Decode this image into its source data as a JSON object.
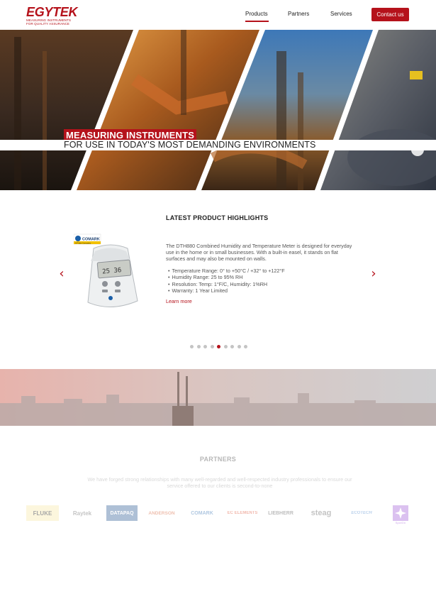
{
  "header": {
    "logo_name": "EGYTEK",
    "logo_tagline_1": "MEASURING INSTRUMENTS",
    "logo_tagline_2": "FOR QUALITY ASSURANCE",
    "nav": {
      "products": "Products",
      "partners": "Partners",
      "services": "Services"
    },
    "contact_label": "Contact us"
  },
  "hero": {
    "title": "MEASURING INSTRUMENTS",
    "subtitle": "FOR USE IN TODAY'S MOST DEMANDING ENVIRONMENTS"
  },
  "highlights": {
    "section_title": "LATEST PRODUCT HIGHLIGHTS",
    "product_brand": "COMARK",
    "product_brand_sub": "A Fluke Company",
    "product_display": "25 36",
    "description": "The DTH880 Combined Humidity and Temperature Meter is designed for everyday use in the home or in small businesses. With a built-in easel, it stands on flat surfaces and may also be mounted on walls.",
    "specs": [
      "Temperature Range: 0° to +50°C / +32° to +122°F",
      "Humidity Range: 25 to 95% RH",
      "Resolution: Temp: 1°F/C, Humidity: 1%RH",
      "Warranty: 1 Year Limited"
    ],
    "learn_more": "Learn more",
    "prev_arrow": "‹",
    "next_arrow": "›",
    "slide_count": 9,
    "active_slide": 4
  },
  "partners": {
    "title": "PARTNERS",
    "text": "We have forged strong relationships with many well-regarded and well-respected industry professionals to ensure our service offered to our clients is second-to-none",
    "logos": [
      {
        "name": "FLUKE",
        "color": "#f2c100"
      },
      {
        "name": "Raytek",
        "color": "#555555"
      },
      {
        "name": "DATAPAQ",
        "color": "#1a4e8c"
      },
      {
        "name": "ANDERSON",
        "color": "#d14a1b"
      },
      {
        "name": "COMARK",
        "color": "#1a5fa8"
      },
      {
        "name": "EC ELEMENTS",
        "color": "#d93a1a"
      },
      {
        "name": "LIEBHERR",
        "color": "#444444"
      },
      {
        "name": "steag",
        "color": "#555555"
      },
      {
        "name": "ECOTECH",
        "color": "#3a7cc8"
      },
      {
        "name": "SpotOn",
        "color": "#9b4fd6"
      }
    ]
  },
  "colors": {
    "brand": "#b5121b",
    "text": "#333333"
  }
}
